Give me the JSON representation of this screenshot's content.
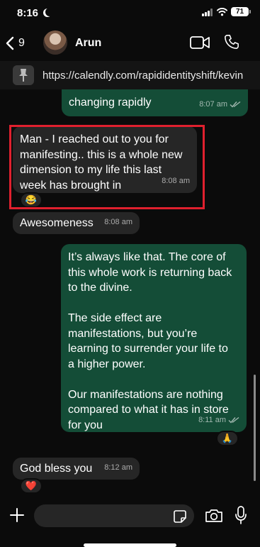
{
  "status_bar": {
    "time": "8:16",
    "battery": "71",
    "icons": [
      "moon-icon",
      "signal-icon",
      "wifi-icon",
      "battery-icon"
    ]
  },
  "header": {
    "back_count": "9",
    "contact_name": "Arun",
    "icons": [
      "chevron-left-icon",
      "video-call-icon",
      "phone-icon"
    ]
  },
  "pinned": {
    "link": "https://calendly.com/rapididentityshift/kevin",
    "icon": "pin-icon"
  },
  "messages": [
    {
      "direction": "out",
      "text": "changing rapidly",
      "time": "8:07 am",
      "status": "read"
    },
    {
      "direction": "in",
      "text": "Man - I reached out to you for\nmanifesting.. this is a whole new\ndimension to my life this last\nweek has brought in",
      "time": "8:08 am",
      "reaction": "😂",
      "highlighted": true
    },
    {
      "direction": "in",
      "text": "Awesomeness",
      "time": "8:08 am"
    },
    {
      "direction": "out",
      "text": "It’s always like that. The core of\nthis whole work is returning back\nto the divine.\n\nThe side effect are\nmanifestations, but you’re\nlearning to surrender your life to\na higher power.\n\nOur manifestations are nothing\ncompared to what it has in store\nfor you",
      "time": "8:11 am",
      "status": "read",
      "reaction": "🙏"
    },
    {
      "direction": "in",
      "text": "God bless you",
      "time": "8:12 am",
      "reaction": "❤️"
    }
  ],
  "composer": {
    "placeholder": "",
    "icons": [
      "plus-icon",
      "sticker-icon",
      "camera-icon",
      "microphone-icon"
    ]
  },
  "colors": {
    "background": "#0b0b0b",
    "incoming_bubble": "#262626",
    "outgoing_bubble": "#144d37",
    "highlight": "#e0202e"
  }
}
